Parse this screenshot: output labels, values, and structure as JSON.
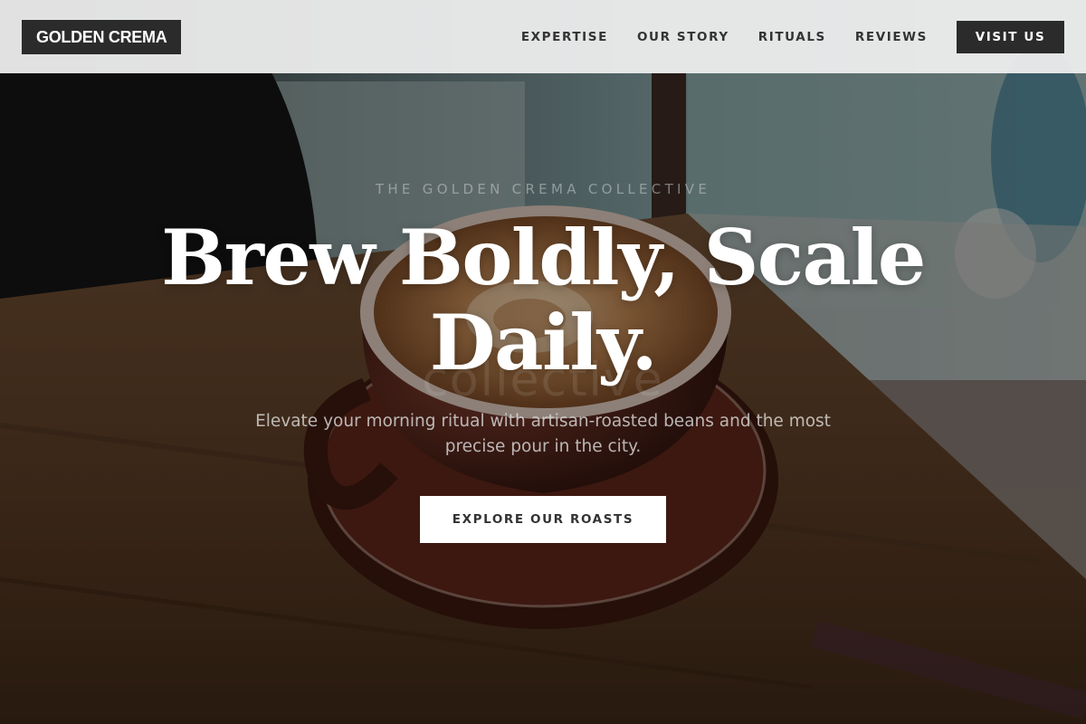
{
  "nav": {
    "logo": "GOLDEN CREMA",
    "links": [
      {
        "label": "EXPERTISE"
      },
      {
        "label": "OUR STORY"
      },
      {
        "label": "RITUALS"
      },
      {
        "label": "REVIEWS"
      }
    ],
    "cta_label": "VISIT US"
  },
  "hero": {
    "eyebrow": "THE GOLDEN CREMA COLLECTIVE",
    "headline": "Brew Boldly, Scale Daily.",
    "ghost_text": "collective",
    "subtext": "Elevate your morning ritual with artisan-roasted beans and the most precise pour in the city.",
    "cta_label": "EXPLORE OUR ROASTS",
    "background_image": "coffee-cup-on-wooden-table-photo"
  },
  "colors": {
    "nav_bg": "#f0f0f0",
    "dark": "#2b2b2b",
    "white": "#ffffff",
    "wood": "#6b4a2e",
    "cup": "#5a2e22"
  }
}
